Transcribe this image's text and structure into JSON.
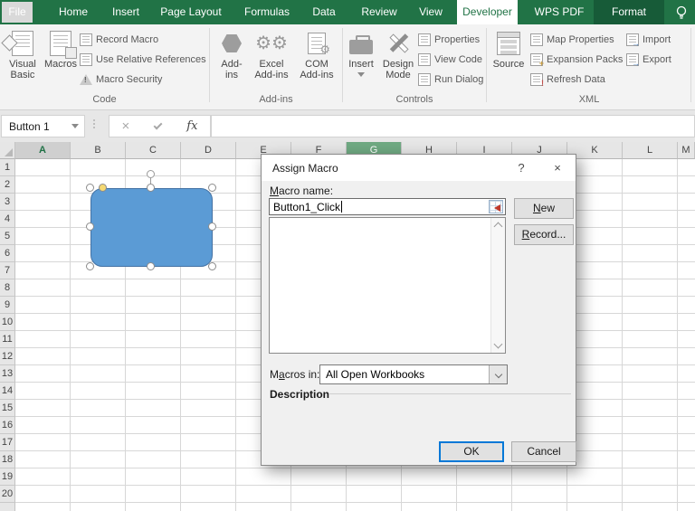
{
  "ribbon_tabs": [
    {
      "label": "File"
    },
    {
      "label": "Home"
    },
    {
      "label": "Insert"
    },
    {
      "label": "Page Layout"
    },
    {
      "label": "Formulas"
    },
    {
      "label": "Data"
    },
    {
      "label": "Review"
    },
    {
      "label": "View"
    },
    {
      "label": "Developer"
    },
    {
      "label": "WPS PDF"
    },
    {
      "label": "Format"
    }
  ],
  "active_tab": "Developer",
  "ribbon": {
    "code": {
      "group_label": "Code",
      "visual_basic_l1": "Visual",
      "visual_basic_l2": "Basic",
      "macros": "Macros",
      "record_macro": "Record Macro",
      "use_relative_references": "Use Relative References",
      "macro_security": "Macro Security"
    },
    "addins": {
      "group_label": "Add-ins",
      "addins_l1": "Add-",
      "addins_l2": "ins",
      "excel_l1": "Excel",
      "excel_l2": "Add-ins",
      "com_l1": "COM",
      "com_l2": "Add-ins"
    },
    "controls": {
      "group_label": "Controls",
      "insert": "Insert",
      "design_l1": "Design",
      "design_l2": "Mode",
      "properties": "Properties",
      "view_code": "View Code",
      "run_dialog": "Run Dialog"
    },
    "xml": {
      "group_label": "XML",
      "source": "Source",
      "map_properties": "Map Properties",
      "expansion_packs": "Expansion Packs",
      "refresh_data": "Refresh Data",
      "import": "Import",
      "export": "Export"
    }
  },
  "formula_bar": {
    "name_box_value": "Button 1",
    "cancel_glyph": "×",
    "fx_glyph": "fx"
  },
  "sheet": {
    "columns": [
      "A",
      "B",
      "C",
      "D",
      "E",
      "F",
      "G",
      "H",
      "I",
      "J",
      "K",
      "L",
      "M"
    ],
    "rows": [
      "1",
      "2",
      "3",
      "4",
      "5",
      "6",
      "7",
      "8",
      "9",
      "10",
      "11",
      "12",
      "13",
      "14",
      "15",
      "16",
      "17",
      "18",
      "19",
      "20"
    ],
    "selected_column": "A",
    "green_selected_column": "G",
    "shape_name": "Button 1"
  },
  "dialog": {
    "title": "Assign Macro",
    "help_glyph": "?",
    "close_glyph": "×",
    "macro_name_label": {
      "pre": "",
      "key": "M",
      "post": "acro name:"
    },
    "macro_name_value": "Button1_Click",
    "new_btn": {
      "pre": "",
      "key": "N",
      "post": "ew"
    },
    "record_btn": {
      "pre": "",
      "key": "R",
      "post": "ecord..."
    },
    "macros_in_label": {
      "pre": "M",
      "key": "a",
      "post": "cros in:"
    },
    "macros_in_value": "All Open Workbooks",
    "description_label": "Description",
    "ok_label": "OK",
    "cancel_label": "Cancel"
  },
  "colors": {
    "ribbon_green": "#217346",
    "contextual_tab_green": "#175b38",
    "active_tab_text": "#217346",
    "shape_fill": "#5b9bd5",
    "shape_border": "#4472a4",
    "selected_column_header_green": "#6fa982",
    "ok_button_border": "#0078d7"
  }
}
